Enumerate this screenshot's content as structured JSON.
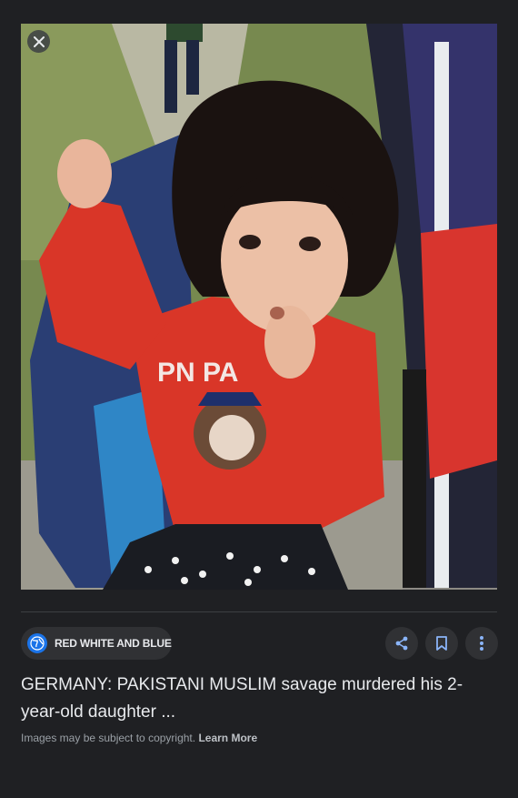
{
  "image": {
    "alt_icon": "close-icon"
  },
  "source": {
    "name": "RED WHITE AND BLUE",
    "icon": "globe-icon",
    "accent": "#1a73e8"
  },
  "actions": {
    "share_icon": "share-icon",
    "save_icon": "bookmark-icon",
    "more_icon": "more-vert-icon"
  },
  "result": {
    "title": "GERMANY: PAKISTANI MUSLIM savage murdered his 2-year-old daughter ...",
    "copyright_text": "Images may be subject to copyright.",
    "learn_more": "Learn More"
  }
}
